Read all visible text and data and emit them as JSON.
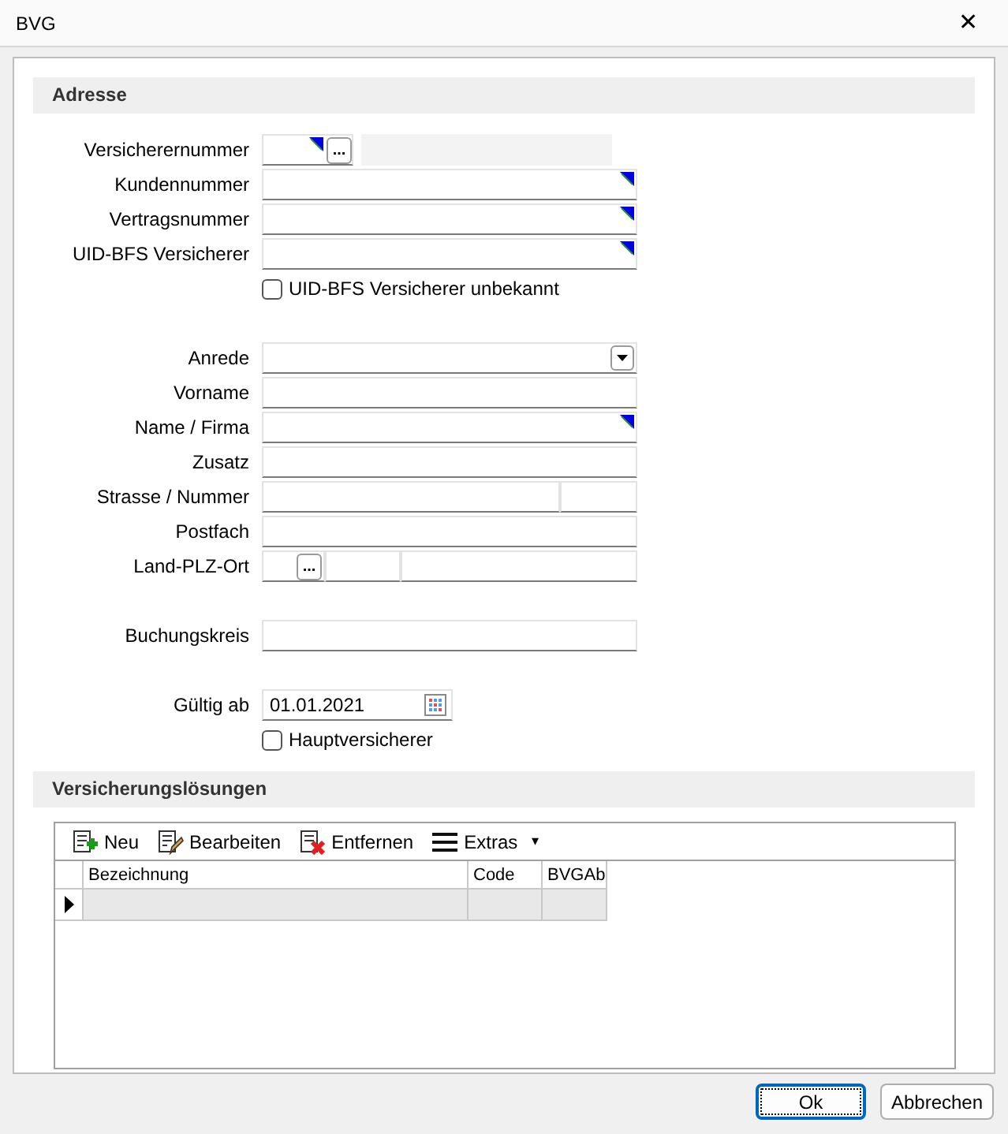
{
  "window": {
    "title": "BVG",
    "close": "✕"
  },
  "address": {
    "heading": "Adresse",
    "groups": [
      [
        {
          "kind": "lookup",
          "label": "Versicherernummer",
          "button": "..."
        },
        {
          "kind": "marked",
          "label": "Kundennummer"
        },
        {
          "kind": "marked",
          "label": "Vertragsnummer"
        },
        {
          "kind": "marked",
          "label": "UID-BFS Versicherer"
        },
        {
          "kind": "checkbox",
          "label": "UID-BFS Versicherer unbekannt",
          "checked": false
        }
      ],
      [
        {
          "kind": "combo",
          "label": "Anrede"
        },
        {
          "kind": "plain",
          "label": "Vorname"
        },
        {
          "kind": "marked",
          "label": "Name / Firma"
        },
        {
          "kind": "plain",
          "label": "Zusatz"
        },
        {
          "kind": "split",
          "label": "Strasse / Nummer"
        },
        {
          "kind": "plain",
          "label": "Postfach"
        },
        {
          "kind": "place",
          "label": "Land-PLZ-Ort",
          "button": "..."
        }
      ],
      [
        {
          "kind": "plain",
          "label": "Buchungskreis"
        }
      ],
      [
        {
          "kind": "date",
          "label": "Gültig ab",
          "value": "01.01.2021"
        },
        {
          "kind": "checkbox",
          "label": "Hauptversicherer",
          "checked": false
        }
      ]
    ]
  },
  "solutions": {
    "heading": "Versicherungslösungen",
    "toolbar": [
      {
        "kind": "new",
        "label": "Neu"
      },
      {
        "kind": "edit",
        "label": "Bearbeiten"
      },
      {
        "kind": "delete",
        "label": "Entfernen"
      },
      {
        "kind": "menu",
        "label": "Extras",
        "caret": "▾"
      }
    ],
    "columns": [
      "Bezeichnung",
      "Code",
      "BVGAb"
    ],
    "rows": [
      {
        "current": true,
        "cells": [
          "",
          "",
          ""
        ]
      }
    ]
  },
  "buttons": [
    {
      "label": "Ok",
      "default": true
    },
    {
      "label": "Abbrechen",
      "default": false
    }
  ]
}
